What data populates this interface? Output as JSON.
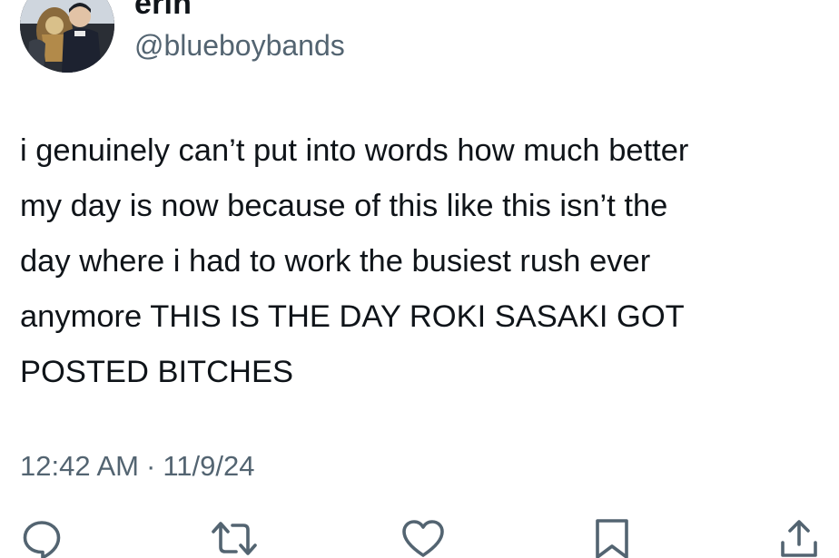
{
  "author": {
    "display_name": "erin",
    "handle": "@blueboybands",
    "avatar_icon": "profile-photo"
  },
  "tweet": {
    "lines": [
      "i genuinely can’t put into words how much better",
      "my day is now because of this like this isn’t the",
      "day where i had to work the busiest rush ever",
      "anymore THIS IS THE DAY ROKI SASAKI GOT",
      "POSTED BITCHES"
    ],
    "time": "12:42 AM",
    "separator": "·",
    "date": "11/9/24"
  },
  "actions": [
    {
      "name": "reply",
      "icon": "speech-bubble-icon"
    },
    {
      "name": "retweet",
      "icon": "retweet-arrows-icon"
    },
    {
      "name": "like",
      "icon": "heart-icon"
    },
    {
      "name": "bookmark",
      "icon": "bookmark-icon"
    },
    {
      "name": "share",
      "icon": "share-icon"
    }
  ],
  "colors": {
    "text": "#0f1419",
    "secondary": "#536471",
    "background": "#ffffff"
  }
}
